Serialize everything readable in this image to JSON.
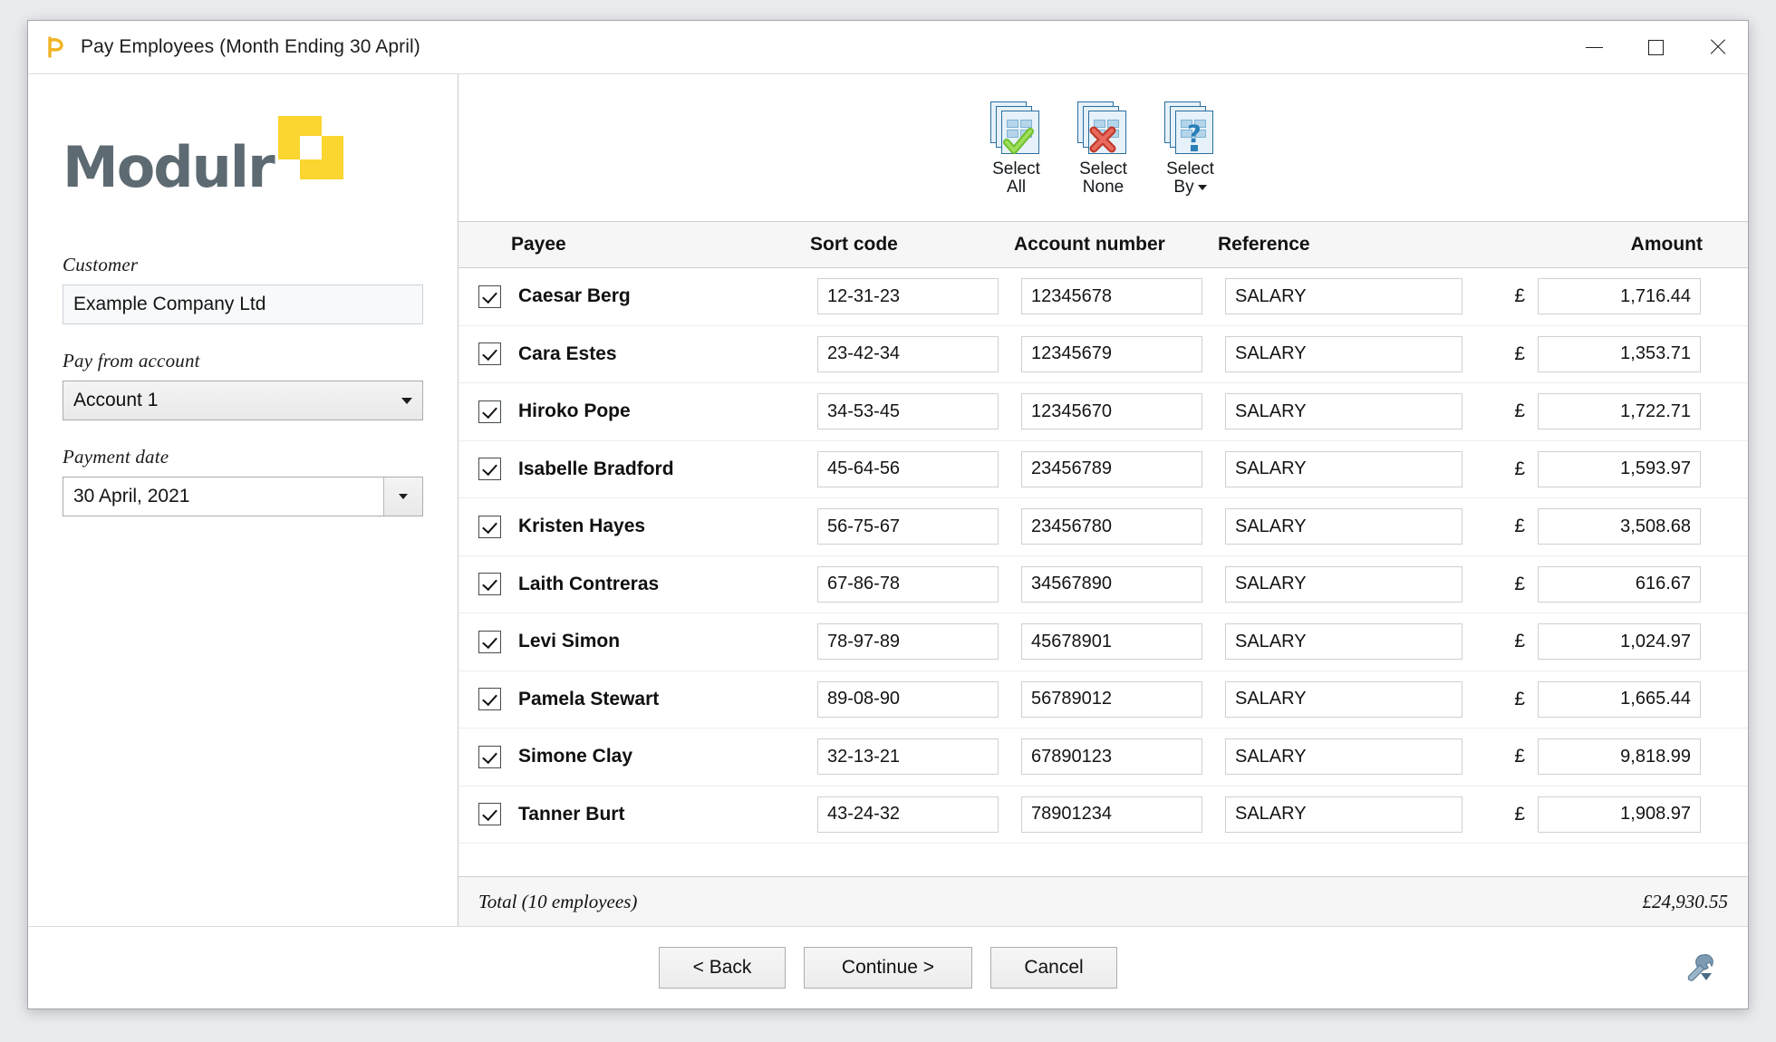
{
  "window": {
    "title": "Pay Employees (Month Ending 30 April)",
    "app_icon": "modulr-logo-icon",
    "controls": {
      "minimize": "minimize-icon",
      "maximize": "maximize-icon",
      "close": "close-icon"
    }
  },
  "sidebar": {
    "brand": "Modulr",
    "customer": {
      "label": "Customer",
      "value": "Example Company Ltd"
    },
    "pay_from_account": {
      "label": "Pay from account",
      "value": "Account 1"
    },
    "payment_date": {
      "label": "Payment date",
      "value": "30 April, 2021"
    }
  },
  "toolbar": {
    "buttons": [
      {
        "line1": "Select",
        "line2": "All",
        "icon": "select-all-icon",
        "has_dropdown": false
      },
      {
        "line1": "Select",
        "line2": "None",
        "icon": "select-none-icon",
        "has_dropdown": false
      },
      {
        "line1": "Select",
        "line2": "By",
        "icon": "select-by-icon",
        "has_dropdown": true
      }
    ]
  },
  "table": {
    "headers": {
      "payee": "Payee",
      "sort_code": "Sort code",
      "account_number": "Account number",
      "reference": "Reference",
      "amount": "Amount"
    },
    "currency_symbol": "£",
    "rows": [
      {
        "checked": true,
        "payee": "Caesar Berg",
        "sort_code": "12-31-23",
        "account_number": "12345678",
        "reference": "SALARY",
        "amount": "1,716.44"
      },
      {
        "checked": true,
        "payee": "Cara Estes",
        "sort_code": "23-42-34",
        "account_number": "12345679",
        "reference": "SALARY",
        "amount": "1,353.71"
      },
      {
        "checked": true,
        "payee": "Hiroko Pope",
        "sort_code": "34-53-45",
        "account_number": "12345670",
        "reference": "SALARY",
        "amount": "1,722.71"
      },
      {
        "checked": true,
        "payee": "Isabelle Bradford",
        "sort_code": "45-64-56",
        "account_number": "23456789",
        "reference": "SALARY",
        "amount": "1,593.97"
      },
      {
        "checked": true,
        "payee": "Kristen Hayes",
        "sort_code": "56-75-67",
        "account_number": "23456780",
        "reference": "SALARY",
        "amount": "3,508.68"
      },
      {
        "checked": true,
        "payee": "Laith Contreras",
        "sort_code": "67-86-78",
        "account_number": "34567890",
        "reference": "SALARY",
        "amount": "616.67"
      },
      {
        "checked": true,
        "payee": "Levi Simon",
        "sort_code": "78-97-89",
        "account_number": "45678901",
        "reference": "SALARY",
        "amount": "1,024.97"
      },
      {
        "checked": true,
        "payee": "Pamela Stewart",
        "sort_code": "89-08-90",
        "account_number": "56789012",
        "reference": "SALARY",
        "amount": "1,665.44"
      },
      {
        "checked": true,
        "payee": "Simone Clay",
        "sort_code": "32-13-21",
        "account_number": "67890123",
        "reference": "SALARY",
        "amount": "9,818.99"
      },
      {
        "checked": true,
        "payee": "Tanner Burt",
        "sort_code": "43-24-32",
        "account_number": "78901234",
        "reference": "SALARY",
        "amount": "1,908.97"
      }
    ]
  },
  "totals": {
    "label": "Total (10 employees)",
    "value": "£24,930.55"
  },
  "footer": {
    "back": "< Back",
    "continue": "Continue >",
    "cancel": "Cancel",
    "settings_icon": "wrench-dropdown-icon"
  },
  "colors": {
    "brand_gray": "#5d6a71",
    "brand_yellow": "#fbd530",
    "icon_blue": "#2a6e9e",
    "check_green": "#7ac943",
    "x_red": "#d94141"
  }
}
